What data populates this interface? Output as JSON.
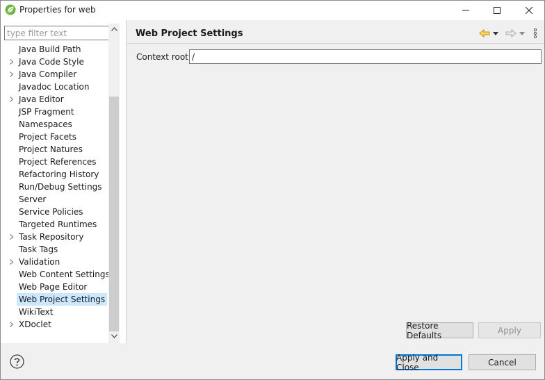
{
  "window": {
    "title": "Properties for web"
  },
  "filter": {
    "placeholder": "type filter text",
    "value": ""
  },
  "tree": {
    "items": [
      {
        "label": "Java Build Path",
        "expandable": false
      },
      {
        "label": "Java Code Style",
        "expandable": true
      },
      {
        "label": "Java Compiler",
        "expandable": true
      },
      {
        "label": "Javadoc Location",
        "expandable": false
      },
      {
        "label": "Java Editor",
        "expandable": true
      },
      {
        "label": "JSP Fragment",
        "expandable": false
      },
      {
        "label": "Namespaces",
        "expandable": false
      },
      {
        "label": "Project Facets",
        "expandable": false
      },
      {
        "label": "Project Natures",
        "expandable": false
      },
      {
        "label": "Project References",
        "expandable": false
      },
      {
        "label": "Refactoring History",
        "expandable": false
      },
      {
        "label": "Run/Debug Settings",
        "expandable": false
      },
      {
        "label": "Server",
        "expandable": false
      },
      {
        "label": "Service Policies",
        "expandable": false
      },
      {
        "label": "Targeted Runtimes",
        "expandable": false
      },
      {
        "label": "Task Repository",
        "expandable": true
      },
      {
        "label": "Task Tags",
        "expandable": false
      },
      {
        "label": "Validation",
        "expandable": true
      },
      {
        "label": "Web Content Settings",
        "expandable": false
      },
      {
        "label": "Web Page Editor",
        "expandable": false
      },
      {
        "label": "Web Project Settings",
        "expandable": false,
        "selected": true
      },
      {
        "label": "WikiText",
        "expandable": false
      },
      {
        "label": "XDoclet",
        "expandable": true
      }
    ]
  },
  "page": {
    "title": "Web Project Settings",
    "context_root_label": "Context root:",
    "context_root_value": "/"
  },
  "buttons": {
    "restore_defaults": "Restore Defaults",
    "apply": "Apply",
    "apply_and_close": "Apply and Close",
    "cancel": "Cancel"
  },
  "colors": {
    "selection": "#cce8ff",
    "accent_blue": "#0078d7",
    "nav_back_arrow": "#e8a317"
  },
  "icons": {
    "app": "spring-leaf-icon",
    "back": "back-arrow-icon",
    "forward": "forward-arrow-icon",
    "menu": "view-menu-icon",
    "help": "help-icon"
  }
}
